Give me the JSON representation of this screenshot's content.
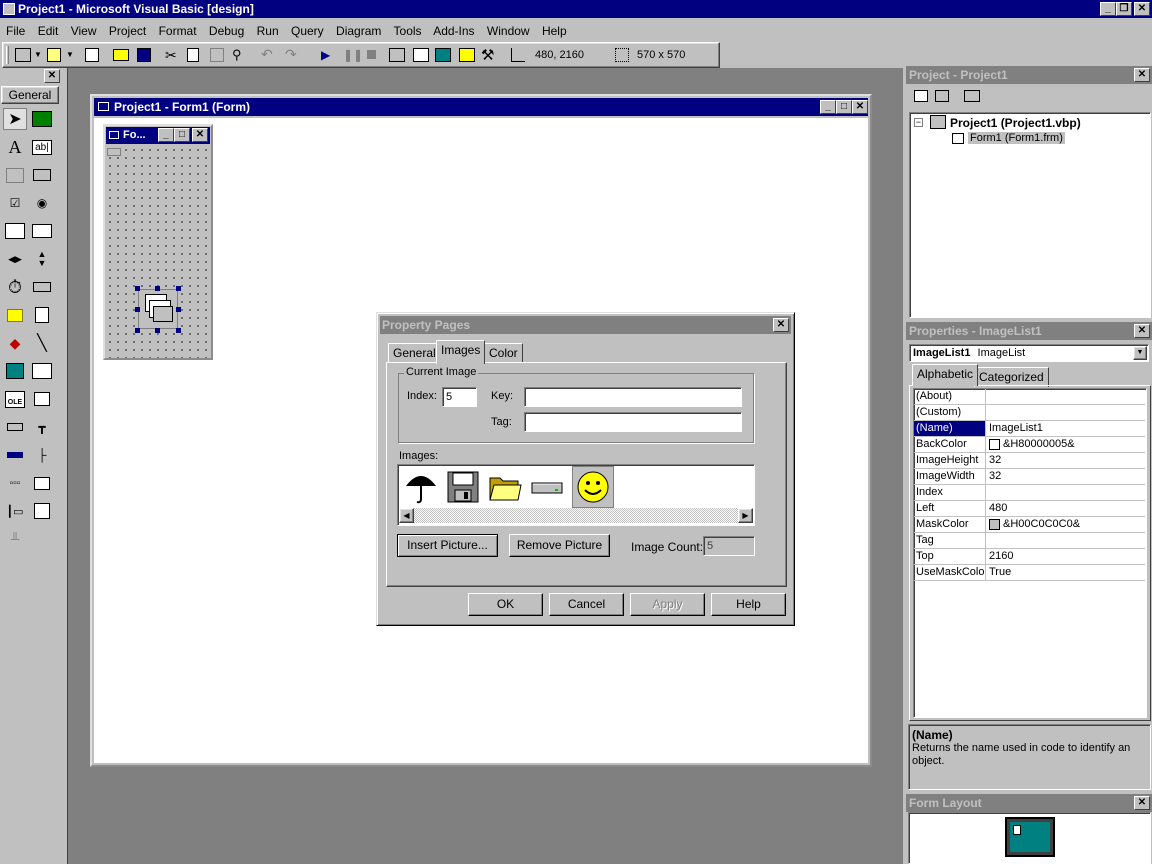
{
  "app": {
    "title": "Project1 - Microsoft Visual Basic [design]"
  },
  "menu": [
    "File",
    "Edit",
    "View",
    "Project",
    "Format",
    "Debug",
    "Run",
    "Query",
    "Diagram",
    "Tools",
    "Add-Ins",
    "Window",
    "Help"
  ],
  "toolbar": {
    "position": "480, 2160",
    "size": "570 x 570"
  },
  "toolbox": {
    "tab_label": "General"
  },
  "form_window": {
    "title": "Project1 - Form1 (Form)",
    "form_title": "Fo..."
  },
  "project_explorer": {
    "title": "Project - Project1",
    "project_node": "Project1 (Project1.vbp)",
    "form_node": "Form1 (Form1.frm)"
  },
  "properties": {
    "title": "Properties - ImageList1",
    "object_name": "ImageList1",
    "object_type": "ImageList",
    "tabs": [
      "Alphabetic",
      "Categorized"
    ],
    "rows": [
      {
        "key": "(About)",
        "value": ""
      },
      {
        "key": "(Custom)",
        "value": ""
      },
      {
        "key": "(Name)",
        "value": "ImageList1"
      },
      {
        "key": "BackColor",
        "value": "&H80000005&"
      },
      {
        "key": "ImageHeight",
        "value": "32"
      },
      {
        "key": "ImageWidth",
        "value": "32"
      },
      {
        "key": "Index",
        "value": ""
      },
      {
        "key": "Left",
        "value": "480"
      },
      {
        "key": "MaskColor",
        "value": "&H00C0C0C0&"
      },
      {
        "key": "Tag",
        "value": ""
      },
      {
        "key": "Top",
        "value": "2160"
      },
      {
        "key": "UseMaskColor",
        "value": "True"
      }
    ],
    "desc_title": "(Name)",
    "desc_text": "Returns the name used in code to identify an object.",
    "colors": {
      "backcolor": "#ffffff",
      "maskcolor": "#c0c0c0"
    }
  },
  "form_layout": {
    "title": "Form Layout"
  },
  "dialog": {
    "title": "Property Pages",
    "tabs": [
      "General",
      "Images",
      "Color"
    ],
    "group_label": "Current Image",
    "index_label": "Index:",
    "index_value": "5",
    "key_label": "Key:",
    "key_value": "",
    "tag_label": "Tag:",
    "tag_value": "",
    "images_label": "Images:",
    "images": [
      "umbrella-icon",
      "floppy-disk-icon",
      "folder-icon",
      "drive-icon",
      "smiley-icon"
    ],
    "insert_button": "Insert Picture...",
    "remove_button": "Remove Picture",
    "count_label": "Image Count:",
    "count_value": "5",
    "ok_button": "OK",
    "cancel_button": "Cancel",
    "apply_button": "Apply",
    "help_button": "Help"
  }
}
